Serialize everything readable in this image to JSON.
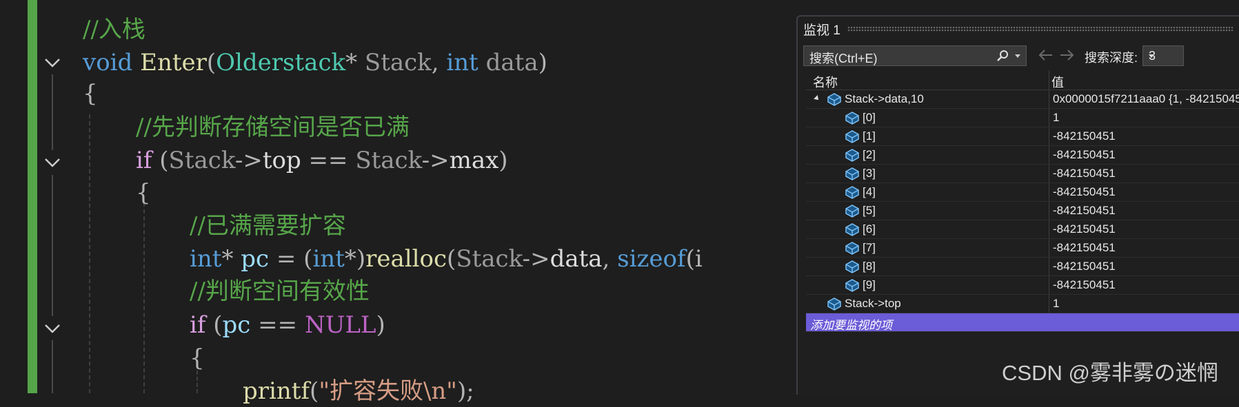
{
  "editor": {
    "lines": [
      {
        "comment": "//入栈"
      },
      {
        "kw": "void",
        "fn": "Enter",
        "p1": "(",
        "type": "Olderstack",
        "star": "*",
        "param1": " Stack",
        "comma": ", ",
        "kw2": "int",
        "param2": " data",
        "p2": ")"
      },
      {
        "brace": "{"
      },
      {
        "comment": "//先判断存储空间是否已满"
      },
      {
        "kw": "if",
        "p1": " (",
        "a": "Stack",
        "arrow": "->",
        "b": "top",
        "op": " == ",
        "c": "Stack",
        "arrow2": "->",
        "d": "max",
        "p2": ")"
      },
      {
        "brace": "{"
      },
      {
        "comment": "//已满需要扩容"
      },
      {
        "kw": "int",
        "star": "*",
        "v": " pc",
        "op": " = ",
        "p1": "(",
        "kw2": "int",
        "star2": "*",
        "p2": ")",
        "fn": "realloc",
        "p3": "(",
        "a": "Stack",
        "arrow": "->",
        "b": "data",
        "comma": ", ",
        "kw3": "sizeof",
        "p4": "(i"
      },
      {
        "comment": "//判断空间有效性"
      },
      {
        "kw": "if",
        "p1": " (",
        "v": "pc",
        "op": " == ",
        "mac": "NULL",
        "p2": ")"
      },
      {
        "brace": "{"
      },
      {
        "fn": "printf",
        "p1": "(",
        "str": "\"扩容失败\\n\"",
        "p2": ");"
      }
    ]
  },
  "watch": {
    "title": "监视 1",
    "search_placeholder": "搜索(Ctrl+E)",
    "depth_label": "搜索深度:",
    "depth_value": "3",
    "col_name": "名称",
    "col_value": "值",
    "rows": [
      {
        "name": "Stack->data,10",
        "value": "0x0000015f7211aaa0 {1, -84215045"
      },
      {
        "name": "[0]",
        "value": "1"
      },
      {
        "name": "[1]",
        "value": "-842150451"
      },
      {
        "name": "[2]",
        "value": "-842150451"
      },
      {
        "name": "[3]",
        "value": "-842150451"
      },
      {
        "name": "[4]",
        "value": "-842150451"
      },
      {
        "name": "[5]",
        "value": "-842150451"
      },
      {
        "name": "[6]",
        "value": "-842150451"
      },
      {
        "name": "[7]",
        "value": "-842150451"
      },
      {
        "name": "[8]",
        "value": "-842150451"
      },
      {
        "name": "[9]",
        "value": "-842150451"
      },
      {
        "name": "Stack->top",
        "value": "1"
      }
    ],
    "add_item": "添加要监视的项",
    "icons": [
      "search-icon",
      "back-arrow-icon",
      "forward-arrow-icon",
      "variable-icon",
      "expand-triangle-icon"
    ]
  },
  "watermark": "CSDN @雾非雾の迷惘",
  "colors": {
    "background": "#1e1e1e",
    "change_bar": "#56a44a",
    "comment": "#57a64a",
    "keyword": "#569cd6",
    "control": "#d8a0df",
    "function": "#dcdcaa",
    "type": "#4ec9b0",
    "selected_row": "#6b5cd8"
  }
}
